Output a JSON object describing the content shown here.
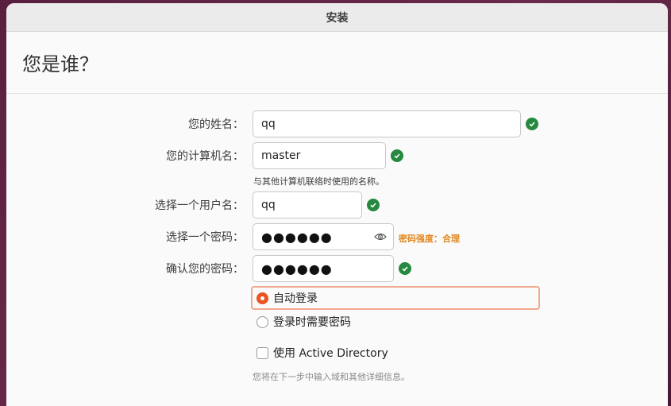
{
  "window": {
    "title": "安装"
  },
  "header": {
    "title": "您是谁？"
  },
  "form": {
    "name": {
      "label": "您的姓名：",
      "value": "qq"
    },
    "computer": {
      "label": "您的计算机名：",
      "value": "master",
      "hint": "与其他计算机联络时使用的名称。"
    },
    "username": {
      "label": "选择一个用户名：",
      "value": "qq"
    },
    "password": {
      "label": "选择一个密码：",
      "value": "●●●●●●",
      "strength": "密码强度：合理"
    },
    "confirm": {
      "label": "确认您的密码：",
      "value": "●●●●●●"
    },
    "login_options": {
      "auto": "自动登录",
      "require_password": "登录时需要密码",
      "selected": "auto"
    },
    "active_directory": {
      "label": "使用 Active Directory",
      "checked": false,
      "hint": "您将在下一步中输入域和其他详细信息。"
    }
  },
  "colors": {
    "accent": "#e95420",
    "ok": "#26893f",
    "warning": "#e0861d"
  },
  "icons": {
    "valid": "check-circle-icon",
    "reveal": "eye-icon"
  }
}
